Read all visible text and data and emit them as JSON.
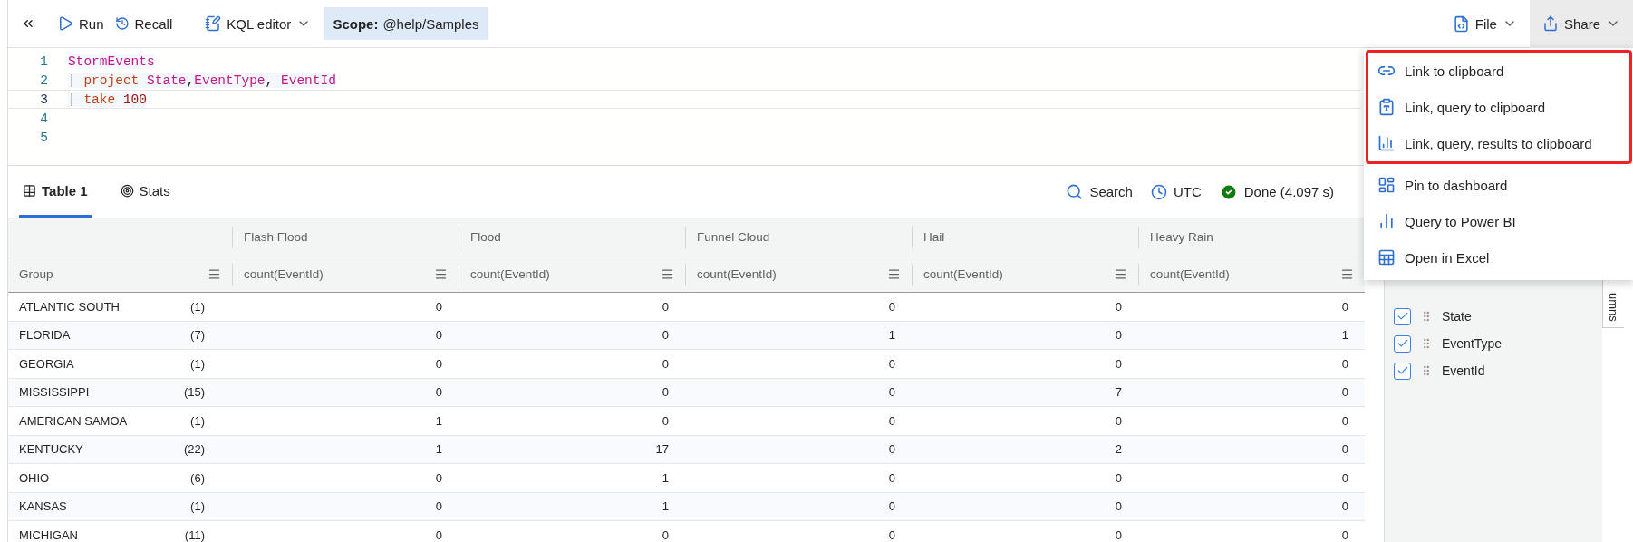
{
  "toolbar": {
    "run": "Run",
    "recall": "Recall",
    "editor_mode": "KQL editor",
    "scope_label": "Scope:",
    "scope_value": "@help/Samples",
    "file": "File",
    "share": {
      "label": "Share",
      "open": true
    }
  },
  "editor": {
    "lines": [
      {
        "number": "1",
        "current": false,
        "tokens": [
          {
            "kind": "table",
            "text": "StormEvents"
          }
        ]
      },
      {
        "number": "2",
        "current": false,
        "tokens": [
          {
            "kind": "pipe",
            "text": "| "
          },
          {
            "kind": "keyword",
            "text": "project "
          },
          {
            "kind": "column",
            "text": "State"
          },
          {
            "kind": "punct",
            "text": ","
          },
          {
            "kind": "column",
            "text": "EventType"
          },
          {
            "kind": "punct",
            "text": ", "
          },
          {
            "kind": "column",
            "text": "EventId"
          }
        ]
      },
      {
        "number": "3",
        "current": true,
        "tokens": [
          {
            "kind": "pipe",
            "text": "| "
          },
          {
            "kind": "keyword",
            "text": "take "
          },
          {
            "kind": "number",
            "text": "100"
          }
        ]
      },
      {
        "number": "4",
        "current": false
      },
      {
        "number": "5",
        "current": false
      }
    ]
  },
  "result_tabs": [
    {
      "label": "Table 1",
      "selected": true
    },
    {
      "label": "Stats",
      "selected": false
    }
  ],
  "result_actions": {
    "search": "Search",
    "timezone": "UTC",
    "status": {
      "text": "Done (4.097 s)"
    }
  },
  "table": {
    "group_header": "Group",
    "columns": [
      {
        "event_type": "Flash Flood",
        "aggregate": "count(EventId)"
      },
      {
        "event_type": "Flood",
        "aggregate": "count(EventId)"
      },
      {
        "event_type": "Funnel Cloud",
        "aggregate": "count(EventId)"
      },
      {
        "event_type": "Hail",
        "aggregate": "count(EventId)"
      },
      {
        "event_type": "Heavy Rain",
        "aggregate": "count(EventId)"
      }
    ],
    "rows": [
      {
        "group": "ATLANTIC SOUTH",
        "count": "(1)",
        "values": [
          "0",
          "0",
          "0",
          "0",
          "0"
        ]
      },
      {
        "group": "FLORIDA",
        "count": "(7)",
        "values": [
          "0",
          "0",
          "1",
          "0",
          "1"
        ]
      },
      {
        "group": "GEORGIA",
        "count": "(1)",
        "values": [
          "0",
          "0",
          "0",
          "0",
          "0"
        ]
      },
      {
        "group": "MISSISSIPPI",
        "count": "(15)",
        "values": [
          "0",
          "0",
          "0",
          "7",
          "0"
        ]
      },
      {
        "group": "AMERICAN SAMOA",
        "count": "(1)",
        "values": [
          "1",
          "0",
          "0",
          "0",
          "0"
        ]
      },
      {
        "group": "KENTUCKY",
        "count": "(22)",
        "values": [
          "1",
          "17",
          "0",
          "2",
          "0"
        ]
      },
      {
        "group": "OHIO",
        "count": "(6)",
        "values": [
          "0",
          "1",
          "0",
          "0",
          "0"
        ]
      },
      {
        "group": "KANSAS",
        "count": "(1)",
        "values": [
          "0",
          "1",
          "0",
          "0",
          "0"
        ]
      },
      {
        "group": "MICHIGAN",
        "count": "(11)",
        "values": [
          "0",
          "0",
          "0",
          "0",
          "0"
        ]
      }
    ]
  },
  "columns_panel": {
    "items": [
      {
        "label": "State",
        "checked": true
      },
      {
        "label": "EventType",
        "checked": true
      },
      {
        "label": "EventId",
        "checked": true
      }
    ],
    "side_tab": "umns"
  },
  "share_menu": {
    "groups": [
      {
        "highlighted": true,
        "items": [
          {
            "label": "Link to clipboard"
          },
          {
            "label": "Link, query to clipboard"
          },
          {
            "label": "Link, query, results to clipboard"
          }
        ]
      },
      {
        "highlighted": false,
        "items": [
          {
            "label": "Pin to dashboard"
          },
          {
            "label": "Query to Power BI"
          },
          {
            "label": "Open in Excel"
          }
        ]
      }
    ]
  }
}
